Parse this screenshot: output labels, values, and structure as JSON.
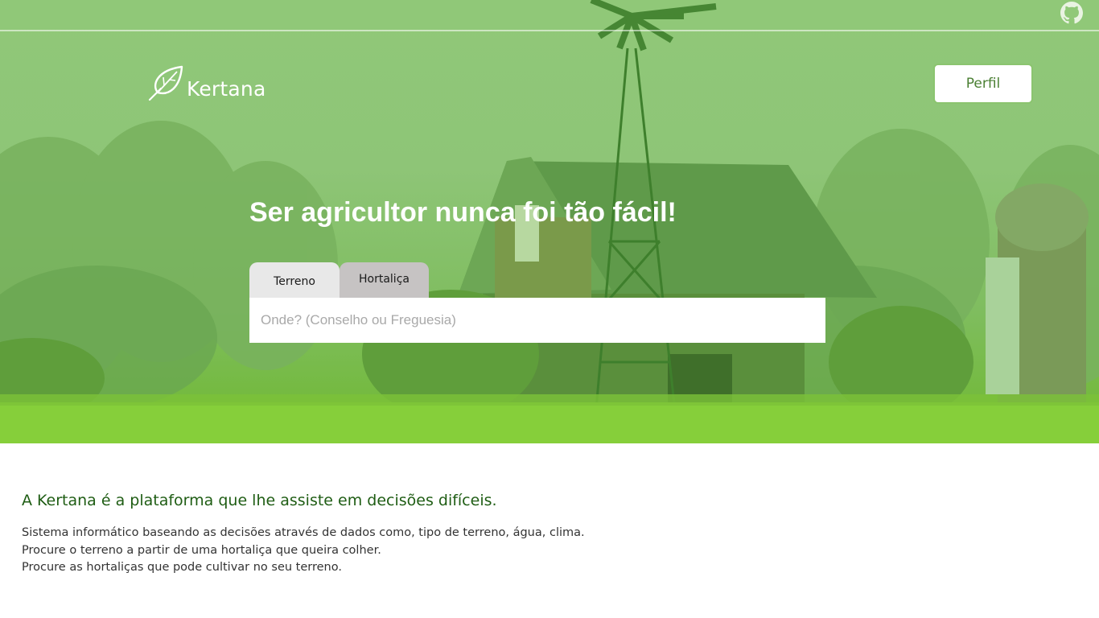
{
  "header": {
    "brand": "Kertana",
    "profile_label": "Perfil",
    "github_icon": "github-icon",
    "logo_icon": "leaf-icon"
  },
  "hero": {
    "headline": "Ser agricultor nunca foi tão fácil!",
    "tabs": [
      {
        "label": "Terreno",
        "active": true
      },
      {
        "label": "Hortaliça",
        "active": false
      }
    ],
    "search_placeholder": "Onde? (Conselho ou Freguesia)",
    "search_value": ""
  },
  "about": {
    "title": "A Kertana é a plataforma que lhe assiste em decisões difíceis.",
    "lines": [
      "Sistema informático baseando as decisões através de dados como, tipo de terreno, água, clima.",
      "Procure o terreno a partir de uma hortaliça que queira colher.",
      "Procure as hortaliças que pode cultivar no seu terreno."
    ]
  },
  "colors": {
    "hero_tint": "#8ec577",
    "grass": "#86cf3a",
    "title_green": "#1f5d14",
    "button_text": "#4a7f33",
    "tab_active": "#e8e8e8",
    "tab_inactive": "#c6c3c3"
  }
}
